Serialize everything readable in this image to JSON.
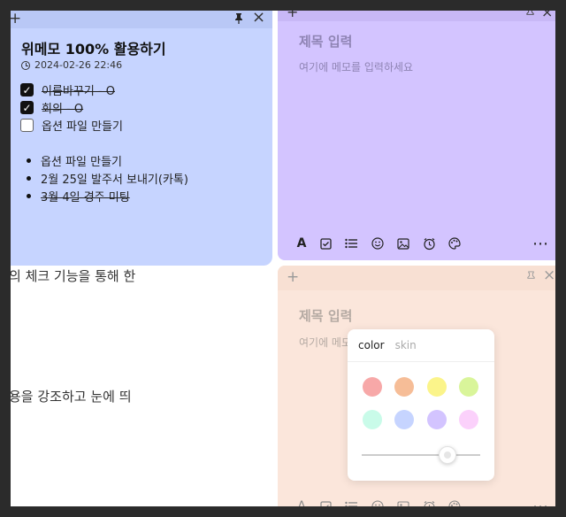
{
  "background": {
    "line1": "의 체크 기능을 통해 한",
    "line2": "용을 강조하고 눈에 띄"
  },
  "note_blue": {
    "add_icon": "+",
    "pin_icon": "pin",
    "close_icon": "×",
    "title": "위메모 100% 활용하기",
    "date": "2024-02-26 22:46",
    "checklist": [
      {
        "label": "이름바꾸기 - O",
        "checked": true
      },
      {
        "label": "회의 - O",
        "checked": true
      },
      {
        "label": "옵션 파일 만들기",
        "checked": false
      }
    ],
    "bullets": [
      {
        "label": "옵션 파일 만들기",
        "done": false
      },
      {
        "label": "2월 25일 발주서 보내기(카톡)",
        "done": false
      },
      {
        "label": "3월 4일 경주 미팅",
        "done": true
      }
    ],
    "color": "#c6d4ff"
  },
  "note_purple": {
    "title_placeholder": "제목 입력",
    "body_placeholder": "여기에 메모를 입력하세요",
    "more_icon": "⋯",
    "color": "#d3c4ff"
  },
  "note_peach": {
    "title_placeholder": "제목 입력",
    "body_placeholder": "여기에 메모를 입력하세요",
    "more_icon": "⋯",
    "color": "#fbe6db"
  },
  "toolbar_icons": [
    "text-format-icon",
    "checkbox-icon",
    "list-icon",
    "emoji-icon",
    "image-icon",
    "alarm-icon",
    "palette-icon"
  ],
  "color_popup": {
    "tabs": [
      "color",
      "skin"
    ],
    "active_tab": "color",
    "swatches": [
      "#f7a8a8",
      "#f6bd97",
      "#fbf48a",
      "#d9f59a",
      "#c9fbe9",
      "#c6d4ff",
      "#d3c4ff",
      "#fbd1fb"
    ],
    "opacity_level": 0.72
  }
}
